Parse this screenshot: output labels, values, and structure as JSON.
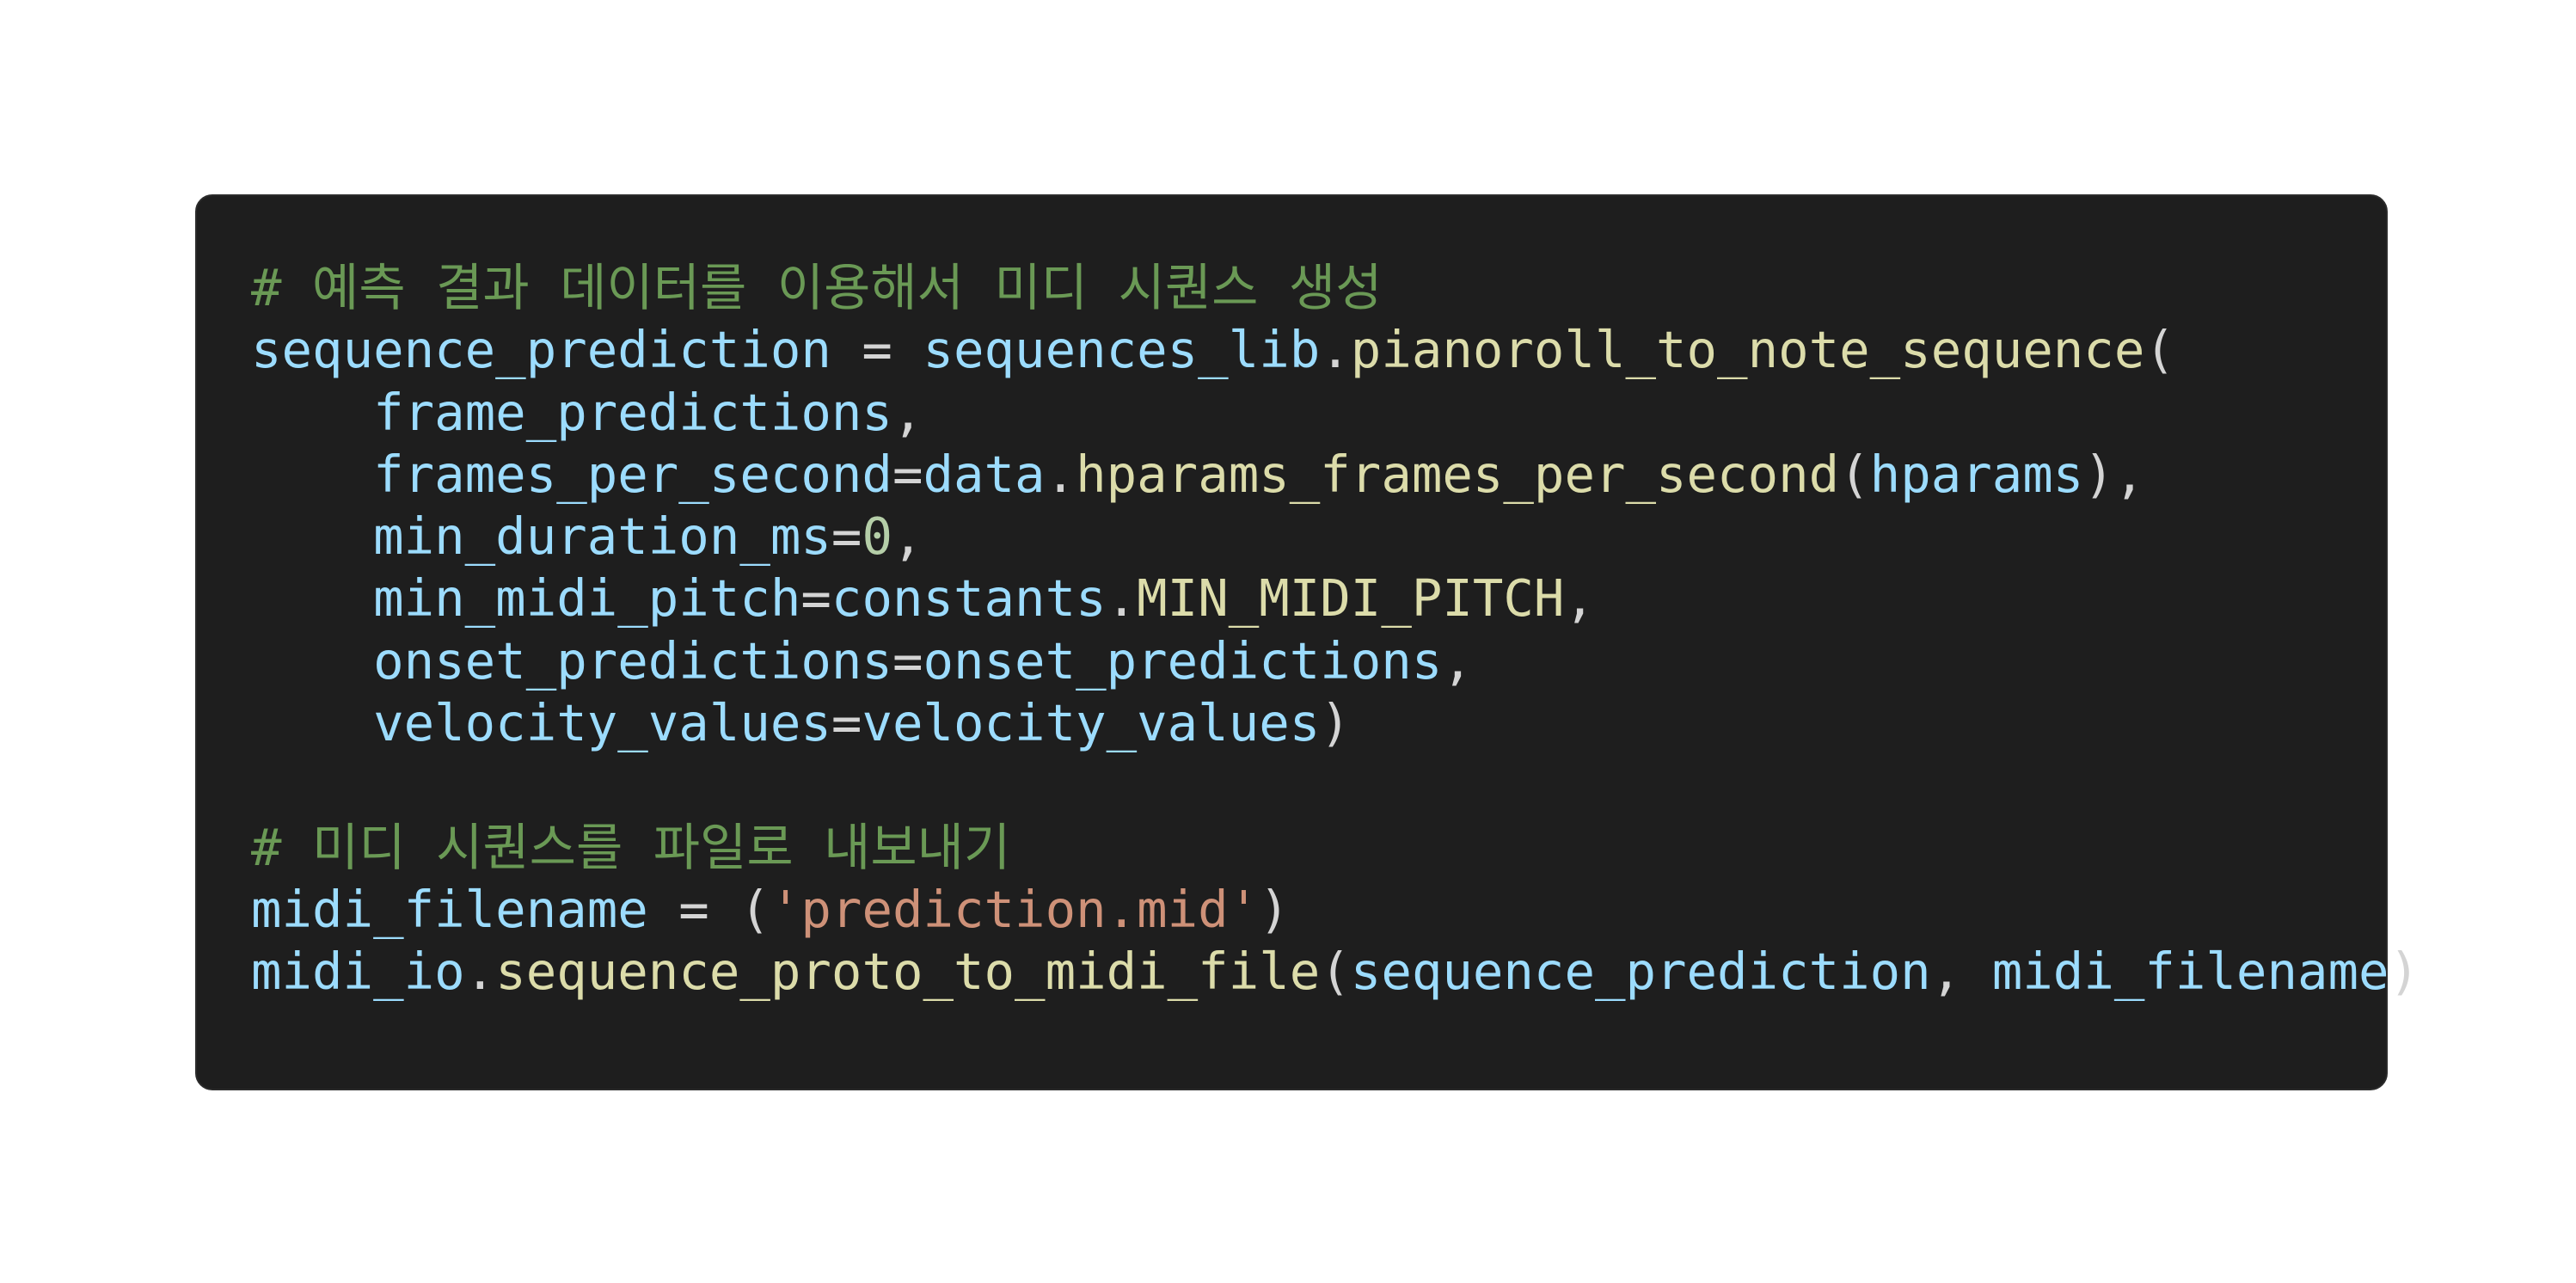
{
  "code": {
    "comment1": "# 예측 결과 데이터를 이용해서 미디 시퀀스 생성",
    "comment2": "# 미디 시퀀스를 파일로 내보내기",
    "tokens": {
      "sequence_prediction": "sequence_prediction",
      "sequences_lib": "sequences_lib",
      "pianoroll_to_note_sequence": "pianoroll_to_note_sequence",
      "frame_predictions": "frame_predictions",
      "frames_per_second": "frames_per_second",
      "data": "data",
      "hparams_frames_per_second": "hparams_frames_per_second",
      "hparams": "hparams",
      "min_duration_ms": "min_duration_ms",
      "zero": "0",
      "min_midi_pitch": "min_midi_pitch",
      "constants": "constants",
      "MIN_MIDI_PITCH": "MIN_MIDI_PITCH",
      "onset_predictions": "onset_predictions",
      "velocity_values": "velocity_values",
      "midi_filename": "midi_filename",
      "prediction_mid": "'prediction.mid'",
      "midi_io": "midi_io",
      "sequence_proto_to_midi_file": "sequence_proto_to_midi_file"
    }
  },
  "colors": {
    "background": "#1e1e1e",
    "comment": "#6a9955",
    "variable": "#9cdcfe",
    "function": "#dcdcaa",
    "string": "#ce9178",
    "number": "#b5cea8",
    "punctuation": "#d4d4d4"
  }
}
